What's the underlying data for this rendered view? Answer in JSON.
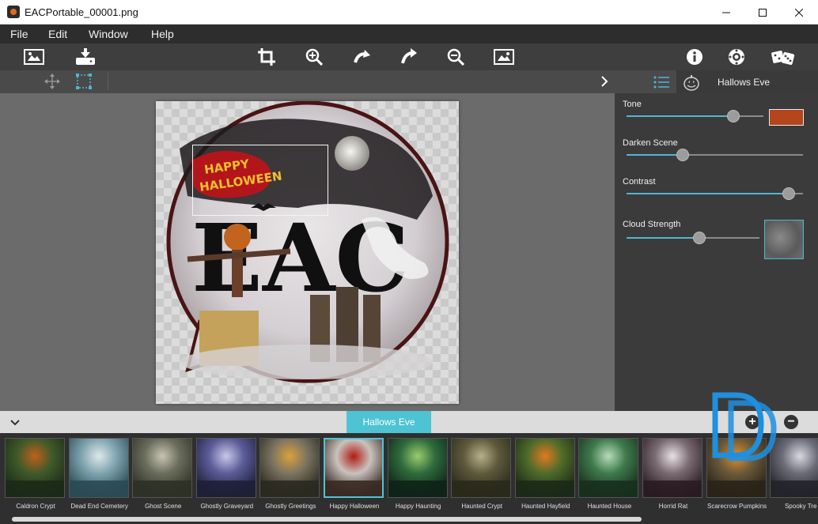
{
  "window": {
    "title": "EACPortable_00001.png",
    "minimize": "minimize",
    "maximize": "maximize",
    "close": "close"
  },
  "menu": [
    "File",
    "Edit",
    "Window",
    "Help"
  ],
  "toolbar": {
    "left": [
      "open-image-icon",
      "save-icon"
    ],
    "center": [
      "crop-icon",
      "zoom-in-icon",
      "undo-icon",
      "redo-icon",
      "zoom-out-icon",
      "fit-image-icon"
    ],
    "right": [
      "info-icon",
      "settings-icon",
      "random-dice-icon"
    ]
  },
  "panel": {
    "title": "Hallows Eve",
    "adjustments": [
      {
        "label": "Tone",
        "value": 0.78,
        "swatch": "#b5451a"
      },
      {
        "label": "Darken Scene",
        "value": 0.32
      },
      {
        "label": "Contrast",
        "value": 0.92
      },
      {
        "label": "Cloud Strength",
        "value": 0.55,
        "swatch_texture": true
      }
    ]
  },
  "strip": {
    "active_tab": "Hallows Eve",
    "items": [
      {
        "label": "Caldron Crypt",
        "palette": [
          "#1c2a18",
          "#3f5a2a",
          "#c0601a"
        ]
      },
      {
        "label": "Dead End Cemetery",
        "palette": [
          "#2a4a55",
          "#7fa4b0",
          "#dfe8ea"
        ]
      },
      {
        "label": "Ghost Scene",
        "palette": [
          "#2e3226",
          "#6b6d5c",
          "#c8c4b4"
        ]
      },
      {
        "label": "Ghostly Graveyard",
        "palette": [
          "#1e2038",
          "#5c5c9a",
          "#c9c7e6"
        ]
      },
      {
        "label": "Ghostly Greetings",
        "palette": [
          "#2a2a20",
          "#7c7462",
          "#d9a23a"
        ]
      },
      {
        "label": "Happy Halloween",
        "palette": [
          "#3a2a24",
          "#c9c2bd",
          "#b01c14"
        ]
      },
      {
        "label": "Happy Haunting",
        "palette": [
          "#0f2418",
          "#2f6b3c",
          "#9acb6d"
        ]
      },
      {
        "label": "Haunted Crypt",
        "palette": [
          "#2a2a1c",
          "#5f5a3c",
          "#b7b08a"
        ]
      },
      {
        "label": "Haunted Hayfield",
        "palette": [
          "#1c2a18",
          "#4f6b2a",
          "#e07a20"
        ]
      },
      {
        "label": "Haunted House",
        "palette": [
          "#18301e",
          "#3f7a4c",
          "#b6dcb8"
        ]
      },
      {
        "label": "Horrid Rat",
        "palette": [
          "#2a1c22",
          "#7a6a72",
          "#e7e1e3"
        ]
      },
      {
        "label": "Scarecrow Pumpkins",
        "palette": [
          "#2a2418",
          "#6b5a3a",
          "#e0902a"
        ]
      },
      {
        "label": "Spooky Tre",
        "palette": [
          "#23232a",
          "#6c6c78",
          "#d8d8e0"
        ]
      }
    ],
    "selected_index": 5
  }
}
